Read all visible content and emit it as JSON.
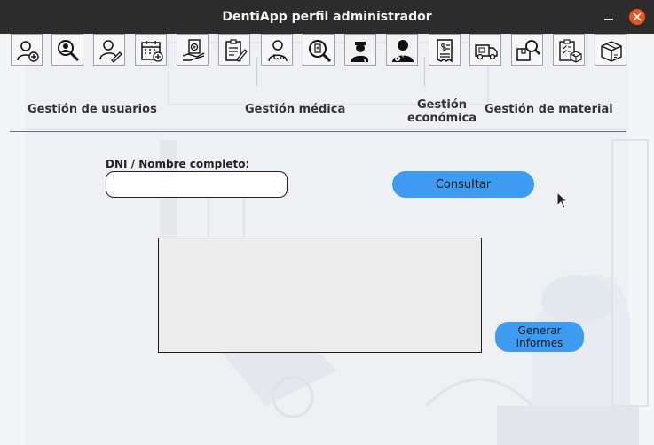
{
  "window": {
    "title": "DentiApp perfil administrador"
  },
  "toolbar": {
    "tools": [
      {
        "name": "add-user-icon"
      },
      {
        "name": "search-user-icon"
      },
      {
        "name": "edit-user-icon"
      },
      {
        "name": "calendar-add-icon"
      },
      {
        "name": "medical-hand-icon"
      },
      {
        "name": "clipboard-edit-icon"
      },
      {
        "name": "doctor-icon"
      },
      {
        "name": "medical-search-icon"
      },
      {
        "name": "doctor-refresh-icon"
      },
      {
        "name": "doctor-settings-icon"
      },
      {
        "name": "invoice-icon"
      },
      {
        "name": "delivery-truck-icon"
      },
      {
        "name": "package-search-icon"
      },
      {
        "name": "inventory-clipboard-icon"
      },
      {
        "name": "box-icon"
      }
    ]
  },
  "sections": {
    "users": "Gestión de usuarios",
    "medical": "Gestión médica",
    "economic_line1": "Gestión",
    "economic_line2": "económica",
    "material": "Gestión de material"
  },
  "form": {
    "search_label": "DNI / Nombre completo:",
    "search_value": "",
    "consult_button": "Consultar",
    "reports_line1": "Generar",
    "reports_line2": "Informes"
  },
  "colors": {
    "accent": "#3d9bf2",
    "close_button": "#e95420",
    "titlebar": "#2c2c2c",
    "divider": "#5b7793"
  }
}
